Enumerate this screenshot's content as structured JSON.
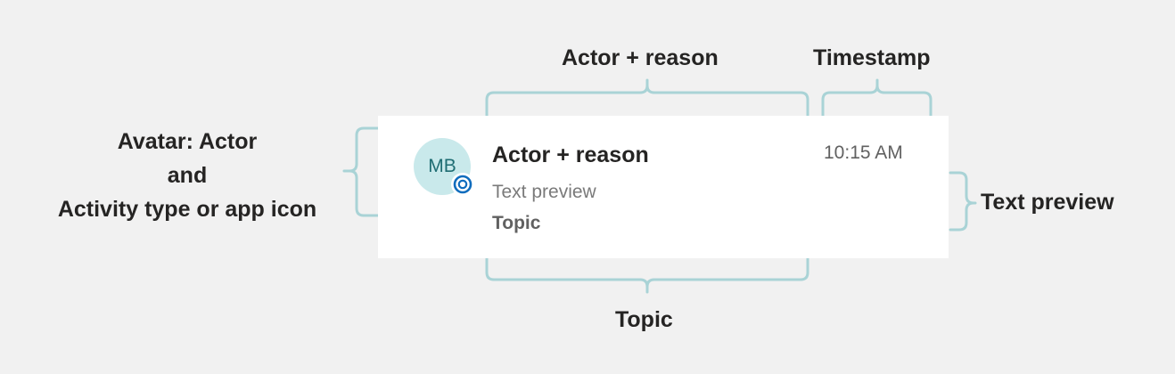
{
  "annotations": {
    "actor_reason": "Actor + reason",
    "timestamp": "Timestamp",
    "avatar_line1": "Avatar: Actor",
    "avatar_line2": "and",
    "avatar_line3": "Activity type or app icon",
    "text_preview": "Text preview",
    "topic": "Topic"
  },
  "card": {
    "avatar_initials": "MB",
    "badge_icon": "activity-app-icon",
    "title": "Actor + reason",
    "preview": "Text preview",
    "topic": "Topic",
    "timestamp": "10:15 AM"
  },
  "colors": {
    "background": "#f1f1f1",
    "bracket": "#a9d3d6",
    "avatar_bg": "#c9e9eb",
    "badge_blue": "#0f6cbd"
  }
}
